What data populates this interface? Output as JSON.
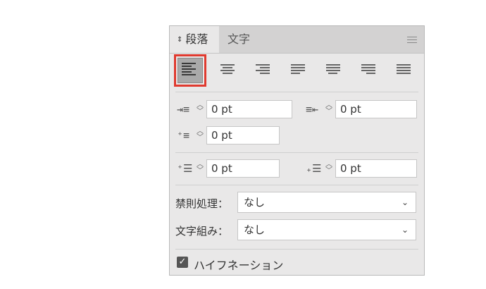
{
  "tabs": {
    "active": "段落",
    "inactive": "文字"
  },
  "alignment": {
    "buttons": [
      {
        "name": "align-left",
        "active": true
      },
      {
        "name": "align-center",
        "active": false
      },
      {
        "name": "align-right",
        "active": false
      },
      {
        "name": "justify-left",
        "active": false
      },
      {
        "name": "justify-center",
        "active": false
      },
      {
        "name": "justify-right",
        "active": false
      },
      {
        "name": "justify-all",
        "active": false
      }
    ]
  },
  "indents": {
    "left_indent": "0 pt",
    "right_indent": "0 pt",
    "first_line_indent": "0 pt",
    "space_before": "0 pt",
    "space_after": "0 pt"
  },
  "kinsoku": {
    "label": "禁則処理：",
    "value": "なし"
  },
  "mojikumi": {
    "label": "文字組み：",
    "value": "なし"
  },
  "hyphenation": {
    "label": "ハイフネーション",
    "checked": true
  },
  "colors": {
    "highlight": "#e03a2f",
    "panel_bg": "#e9e8e8",
    "tab_bar_bg": "#d3d2d2"
  }
}
